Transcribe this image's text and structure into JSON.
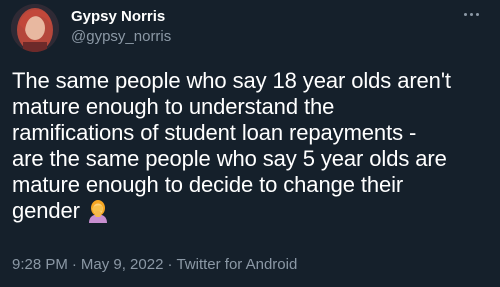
{
  "author": {
    "display_name": "Gypsy Norris",
    "handle": "@gypsy_norris",
    "avatar_icon": "profile-photo"
  },
  "more_icon": "more-horizontal-icon",
  "tweet": {
    "lines": [
      "The same people who say 18 year olds aren't",
      "mature enough to understand the",
      "ramifications of student loan repayments -",
      "are the same people who say 5 year olds are",
      "mature enough to decide to change their",
      "gender"
    ],
    "emoji": "person-facepalming-icon"
  },
  "meta": {
    "time": "9:28 PM",
    "separator": "·",
    "date": "May 9, 2022",
    "source": "Twitter for Android"
  },
  "colors": {
    "background": "#15202b",
    "text_primary": "#ffffff",
    "text_secondary": "#8b98a5"
  }
}
